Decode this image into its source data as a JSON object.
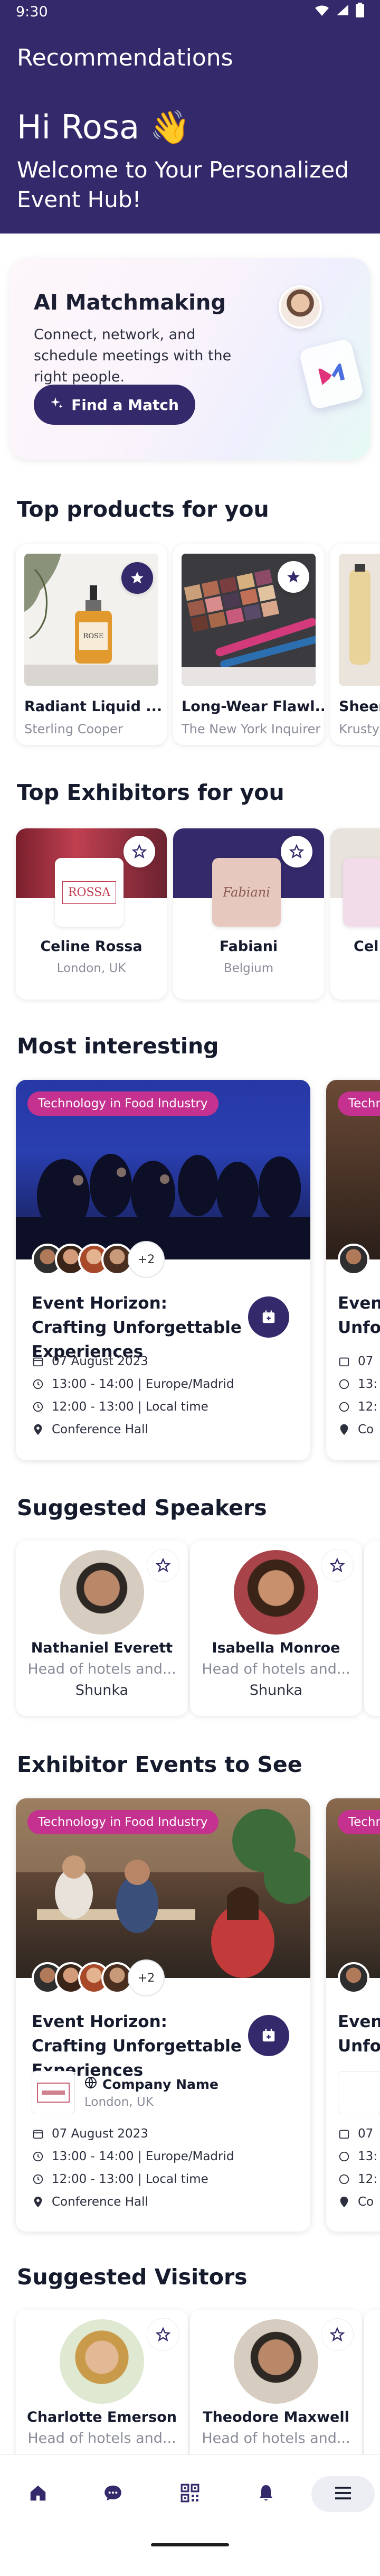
{
  "status_bar": {
    "time": "9:30"
  },
  "header": {
    "title": "Recommendations",
    "greeting": "Hi Rosa 👋",
    "welcome": "Welcome to Your Personalized Event Hub!"
  },
  "ai_match": {
    "title": "AI Matchmaking",
    "description": "Connect, network, and schedule meetings with the right people.",
    "button_label": "Find a Match"
  },
  "sections": {
    "top_products": "Top products for you",
    "top_exhibitors": "Top Exhibitors for you",
    "most_interesting": "Most interesting",
    "suggested_speakers": "Suggested Speakers",
    "exhibitor_events": "Exhibitor Events to See",
    "suggested_visitors": "Suggested Visitors"
  },
  "products": [
    {
      "name": "Radiant Liquid ...",
      "company": "Sterling Cooper",
      "starred": true,
      "label_text": "ROSE"
    },
    {
      "name": "Long-Wear Flawl...",
      "company": "The New York Inquirer",
      "starred": true
    },
    {
      "name": "Sheer L",
      "company": "Krusty",
      "starred": false
    }
  ],
  "exhibitors": [
    {
      "name": "Celine Rossa",
      "location": "London, UK",
      "logo_text": "ROSSA"
    },
    {
      "name": "Fabiani",
      "location": "Belgium",
      "logo_text": "Fabiani"
    },
    {
      "name": "Cel",
      "location": ""
    }
  ],
  "events": [
    {
      "tag": "Technology in Food Industry",
      "attendees_more": "+2",
      "title": "Event Horizon: Crafting Unforgettable Experiences",
      "date": "07 August 2023",
      "time1": "13:00 - 14:00 | Europe/Madrid",
      "time2": "12:00 - 13:00 | Local time",
      "location": "Conference Hall"
    },
    {
      "tag": "Techn",
      "title": "Event Unfor",
      "date": "07",
      "time1": "13:",
      "time2": "12:",
      "location": "Co"
    }
  ],
  "speakers": [
    {
      "name": "Nathaniel Everett",
      "role": "Head of hotels and...",
      "company": "Shunka"
    },
    {
      "name": "Isabella Monroe",
      "role": "Head of hotels and...",
      "company": "Shunka"
    }
  ],
  "exhibitor_events": [
    {
      "tag": "Technology in Food Industry",
      "attendees_more": "+2",
      "title": "Event Horizon: Crafting Unforgettable Experiences",
      "company_name": "Company Name",
      "company_location": "London, UK",
      "date": "07 August 2023",
      "time1": "13:00 - 14:00 | Europe/Madrid",
      "time2": "12:00 - 13:00 | Local time",
      "location": "Conference Hall"
    },
    {
      "tag": "Techn",
      "title": "Event Unfor",
      "date": "07",
      "time1": "13:",
      "time2": "12:",
      "location": "Co"
    }
  ],
  "visitors": [
    {
      "name": "Charlotte Emerson",
      "role": "Head of hotels and..."
    },
    {
      "name": "Theodore Maxwell",
      "role": "Head of hotels and..."
    }
  ],
  "bottom_nav": [
    "home-icon",
    "chat-icon",
    "qr-code-icon",
    "bell-icon",
    "menu-icon"
  ],
  "colors": {
    "primary": "#34296a",
    "tag": "#c4318f",
    "muted": "#8a8d99"
  }
}
